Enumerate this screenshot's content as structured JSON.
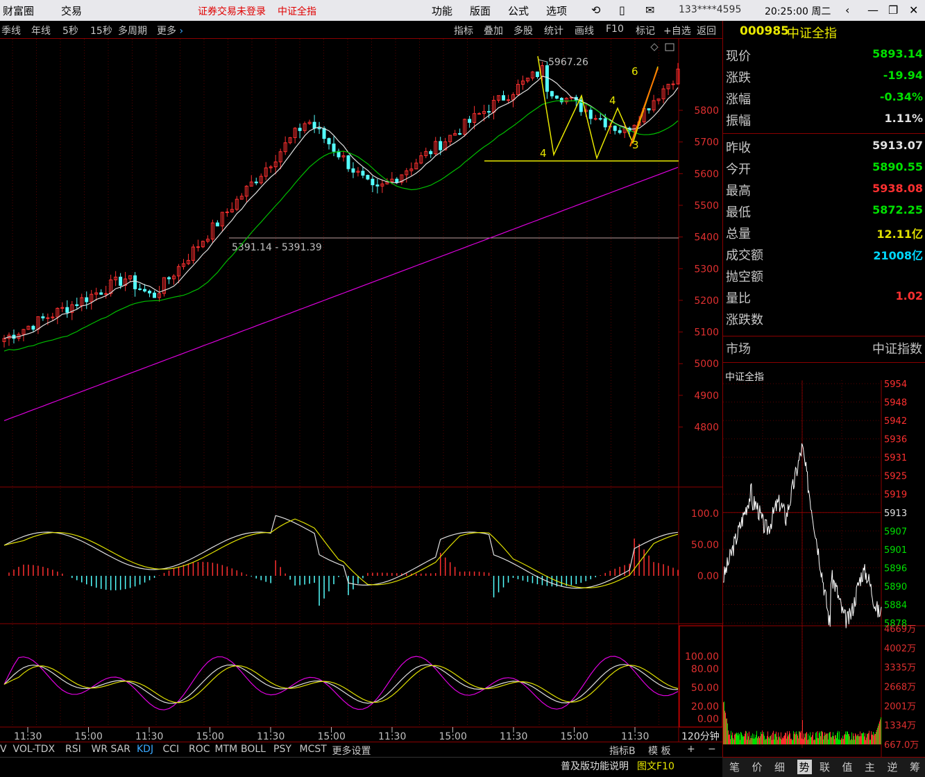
{
  "titlebar": {
    "app_name": "财富圈",
    "trade": "交易",
    "login_status": "证券交易未登录",
    "index_name": "中证全指",
    "menu": [
      "功能",
      "版面",
      "公式",
      "选项"
    ],
    "account": "133****4595",
    "clock": "20:25:00 周二"
  },
  "toolbar": {
    "periods": [
      "季线",
      "年线",
      "5秒",
      "15秒",
      "多周期"
    ],
    "more": "更多",
    "tools": [
      "指标",
      "叠加",
      "多股",
      "统计",
      "画线",
      "F10",
      "标记",
      "+自选",
      "返回"
    ]
  },
  "kline": {
    "y_ticks": [
      "5800",
      "5700",
      "5600",
      "5500",
      "5400",
      "5300",
      "5200",
      "5100",
      "5000",
      "4900",
      "4800"
    ],
    "high_label": "5967.26",
    "range_label": "5391.14 - 5391.39",
    "pattern_labels": [
      "4",
      "4",
      "3",
      "6"
    ],
    "support_line": "5640"
  },
  "macd": {
    "y_ticks": [
      "100.0",
      "50.00",
      "0.00"
    ]
  },
  "kdj": {
    "y_ticks": [
      "100.00",
      "80.00",
      "50.00",
      "20.00",
      "0.00"
    ]
  },
  "time_axis": [
    "11:30",
    "15:00",
    "11:30",
    "15:00",
    "11:30",
    "15:00",
    "11:30",
    "15:00",
    "11:30",
    "15:00",
    "11:30"
  ],
  "period_label": "120分钟",
  "bottom_tabs": [
    "V",
    "VOL-TDX",
    "RSI",
    "WR",
    "SAR",
    "KDJ",
    "CCI",
    "ROC",
    "MTM",
    "BOLL",
    "PSY",
    "MCST",
    "更多",
    "设置"
  ],
  "bottom_right": {
    "indicator": "指标B",
    "template": "模 板",
    "plus": "+",
    "minus": "−"
  },
  "statusbar": {
    "help": "普及版功能说明",
    "f10": "图文F10"
  },
  "quote": {
    "code": "000985",
    "name": "中证全指",
    "rows": [
      {
        "label": "现价",
        "value": "5893.14",
        "color": "#00e000"
      },
      {
        "label": "涨跌",
        "value": "-19.94",
        "color": "#00e000"
      },
      {
        "label": "涨幅",
        "value": "-0.34%",
        "color": "#00e000"
      },
      {
        "label": "振幅",
        "value": "1.11%",
        "color": "#e0e0e0"
      },
      {
        "label": "昨收",
        "value": "5913.07",
        "color": "#e0e0e0"
      },
      {
        "label": "今开",
        "value": "5890.55",
        "color": "#00e000"
      },
      {
        "label": "最高",
        "value": "5938.08",
        "color": "#ff3030"
      },
      {
        "label": "最低",
        "value": "5872.25",
        "color": "#00e000"
      },
      {
        "label": "总量",
        "value": "12.11亿",
        "color": "#e0e000"
      },
      {
        "label": "成交额",
        "value": "21008亿",
        "color": "#00d8ff"
      },
      {
        "label": "抛空额",
        "value": "",
        "color": "#e0e0e0"
      },
      {
        "label": "量比",
        "value": "1.02",
        "color": "#ff3030"
      },
      {
        "label": "涨跌数",
        "value": "",
        "color": "#e0e0e0"
      }
    ],
    "market_label": "市场",
    "market_value": "中证指数"
  },
  "intraday": {
    "title": "中证全指",
    "price_ticks": [
      "5954",
      "5948",
      "5942",
      "5936",
      "5931",
      "5925",
      "5919",
      "5913",
      "5907",
      "5901",
      "5896",
      "5890",
      "5884",
      "5878"
    ],
    "vol_ticks": [
      "4669万",
      "4002万",
      "3335万",
      "2668万",
      "2001万",
      "1334万",
      "667.0万"
    ]
  },
  "right_tabs": [
    "笔",
    "价",
    "细",
    "势",
    "联",
    "值",
    "主",
    "逆",
    "筹"
  ],
  "colors": {
    "up": "#ff3030",
    "down": "#54ffff",
    "ma1": "#e0e0e0",
    "ma2": "#00c000",
    "ma3": "#e000e0",
    "pattern": "#e8e800",
    "grid": "#8b0000"
  }
}
